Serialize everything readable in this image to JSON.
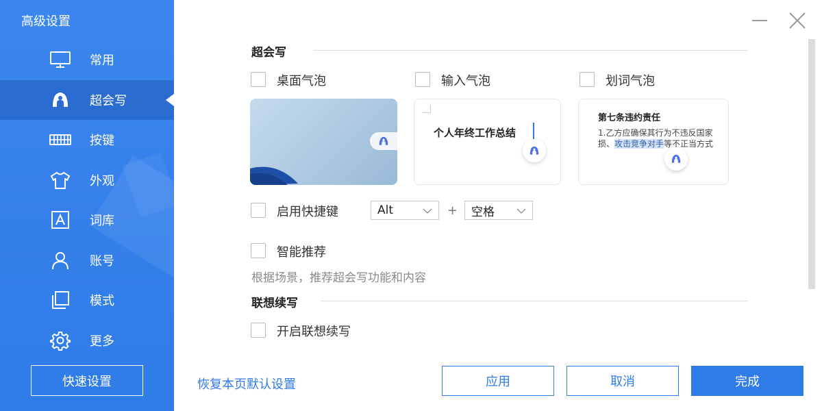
{
  "sidebar": {
    "title": "高级设置",
    "items": [
      {
        "label": "常用",
        "icon": "monitor-icon"
      },
      {
        "label": "超会写",
        "icon": "brand-a-icon",
        "active": true
      },
      {
        "label": "按键",
        "icon": "keyboard-icon"
      },
      {
        "label": "外观",
        "icon": "tshirt-icon"
      },
      {
        "label": "词库",
        "icon": "lexicon-a-icon"
      },
      {
        "label": "账号",
        "icon": "user-icon"
      },
      {
        "label": "模式",
        "icon": "layers-icon"
      },
      {
        "label": "更多",
        "icon": "gear-icon"
      }
    ],
    "quick_settings": "快速设置"
  },
  "colors": {
    "accent": "#2f7be8",
    "sidebar_bg": "#3b86ee",
    "sidebar_active": "#2a6cd0"
  },
  "main": {
    "section1_title": "超会写",
    "bubbles": {
      "desktop": "桌面气泡",
      "input": "输入气泡",
      "select": "划词气泡"
    },
    "card2": {
      "text": "个人年终工作总结"
    },
    "card3": {
      "title": "第七条违约责任",
      "line1": "1.乙方应确保其行为不违反国家",
      "line2_pre": "损、",
      "line2_hl": "攻击竞争对手",
      "line2_post": "等不正当方式"
    },
    "shortcut": {
      "label": "启用快捷键",
      "key1": "Alt",
      "plus": "+",
      "key2": "空格"
    },
    "smart": {
      "label": "智能推荐",
      "desc": "根据场景，推荐超会写功能和内容"
    },
    "section2_title": "联想续写",
    "continue": {
      "label": "开启联想续写"
    }
  },
  "footer": {
    "restore": "恢复本页默认设置",
    "apply": "应用",
    "cancel": "取消",
    "done": "完成"
  }
}
